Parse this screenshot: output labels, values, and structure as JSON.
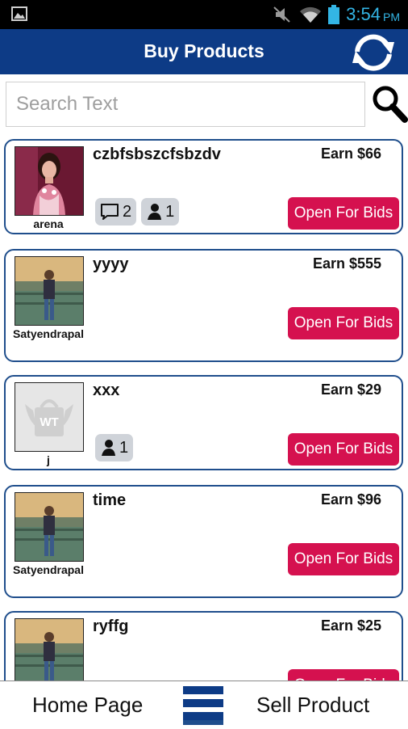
{
  "status_bar": {
    "time": "3:54",
    "ampm": "PM",
    "icons": [
      "image-icon",
      "mute-icon",
      "wifi-icon",
      "battery-icon"
    ]
  },
  "header": {
    "title": "Buy Products",
    "refresh_icon": "refresh-icon"
  },
  "search": {
    "placeholder": "Search Text",
    "value": "",
    "icon": "search-icon"
  },
  "products": [
    {
      "title": "czbfsbszcfsbzdv",
      "earn": "Earn $66",
      "seller": "arena",
      "button": "Open For Bids",
      "comments": "2",
      "bidders": "1",
      "avatar": "girl-photo"
    },
    {
      "title": "yyyy",
      "earn": "Earn $555",
      "seller": "Satyendrapal",
      "button": "Open For Bids",
      "avatar": "man-photo"
    },
    {
      "title": "xxx",
      "earn": "Earn $29",
      "seller": "j",
      "button": "Open For Bids",
      "bidders": "1",
      "avatar": "wt-logo"
    },
    {
      "title": "time",
      "earn": "Earn $96",
      "seller": "Satyendrapal",
      "button": "Open For Bids",
      "avatar": "man-photo"
    },
    {
      "title": "ryffg",
      "earn": "Earn $25",
      "seller": "",
      "button": "Open For Bids",
      "avatar": "man-photo"
    }
  ],
  "nav": {
    "home": "Home Page",
    "sell": "Sell Product",
    "menu_icon": "menu-icon"
  },
  "colors": {
    "header_bg": "#0d3b86",
    "card_border": "#1f4e8c",
    "bid_button": "#d5114f",
    "status_accent": "#33b5e5"
  }
}
